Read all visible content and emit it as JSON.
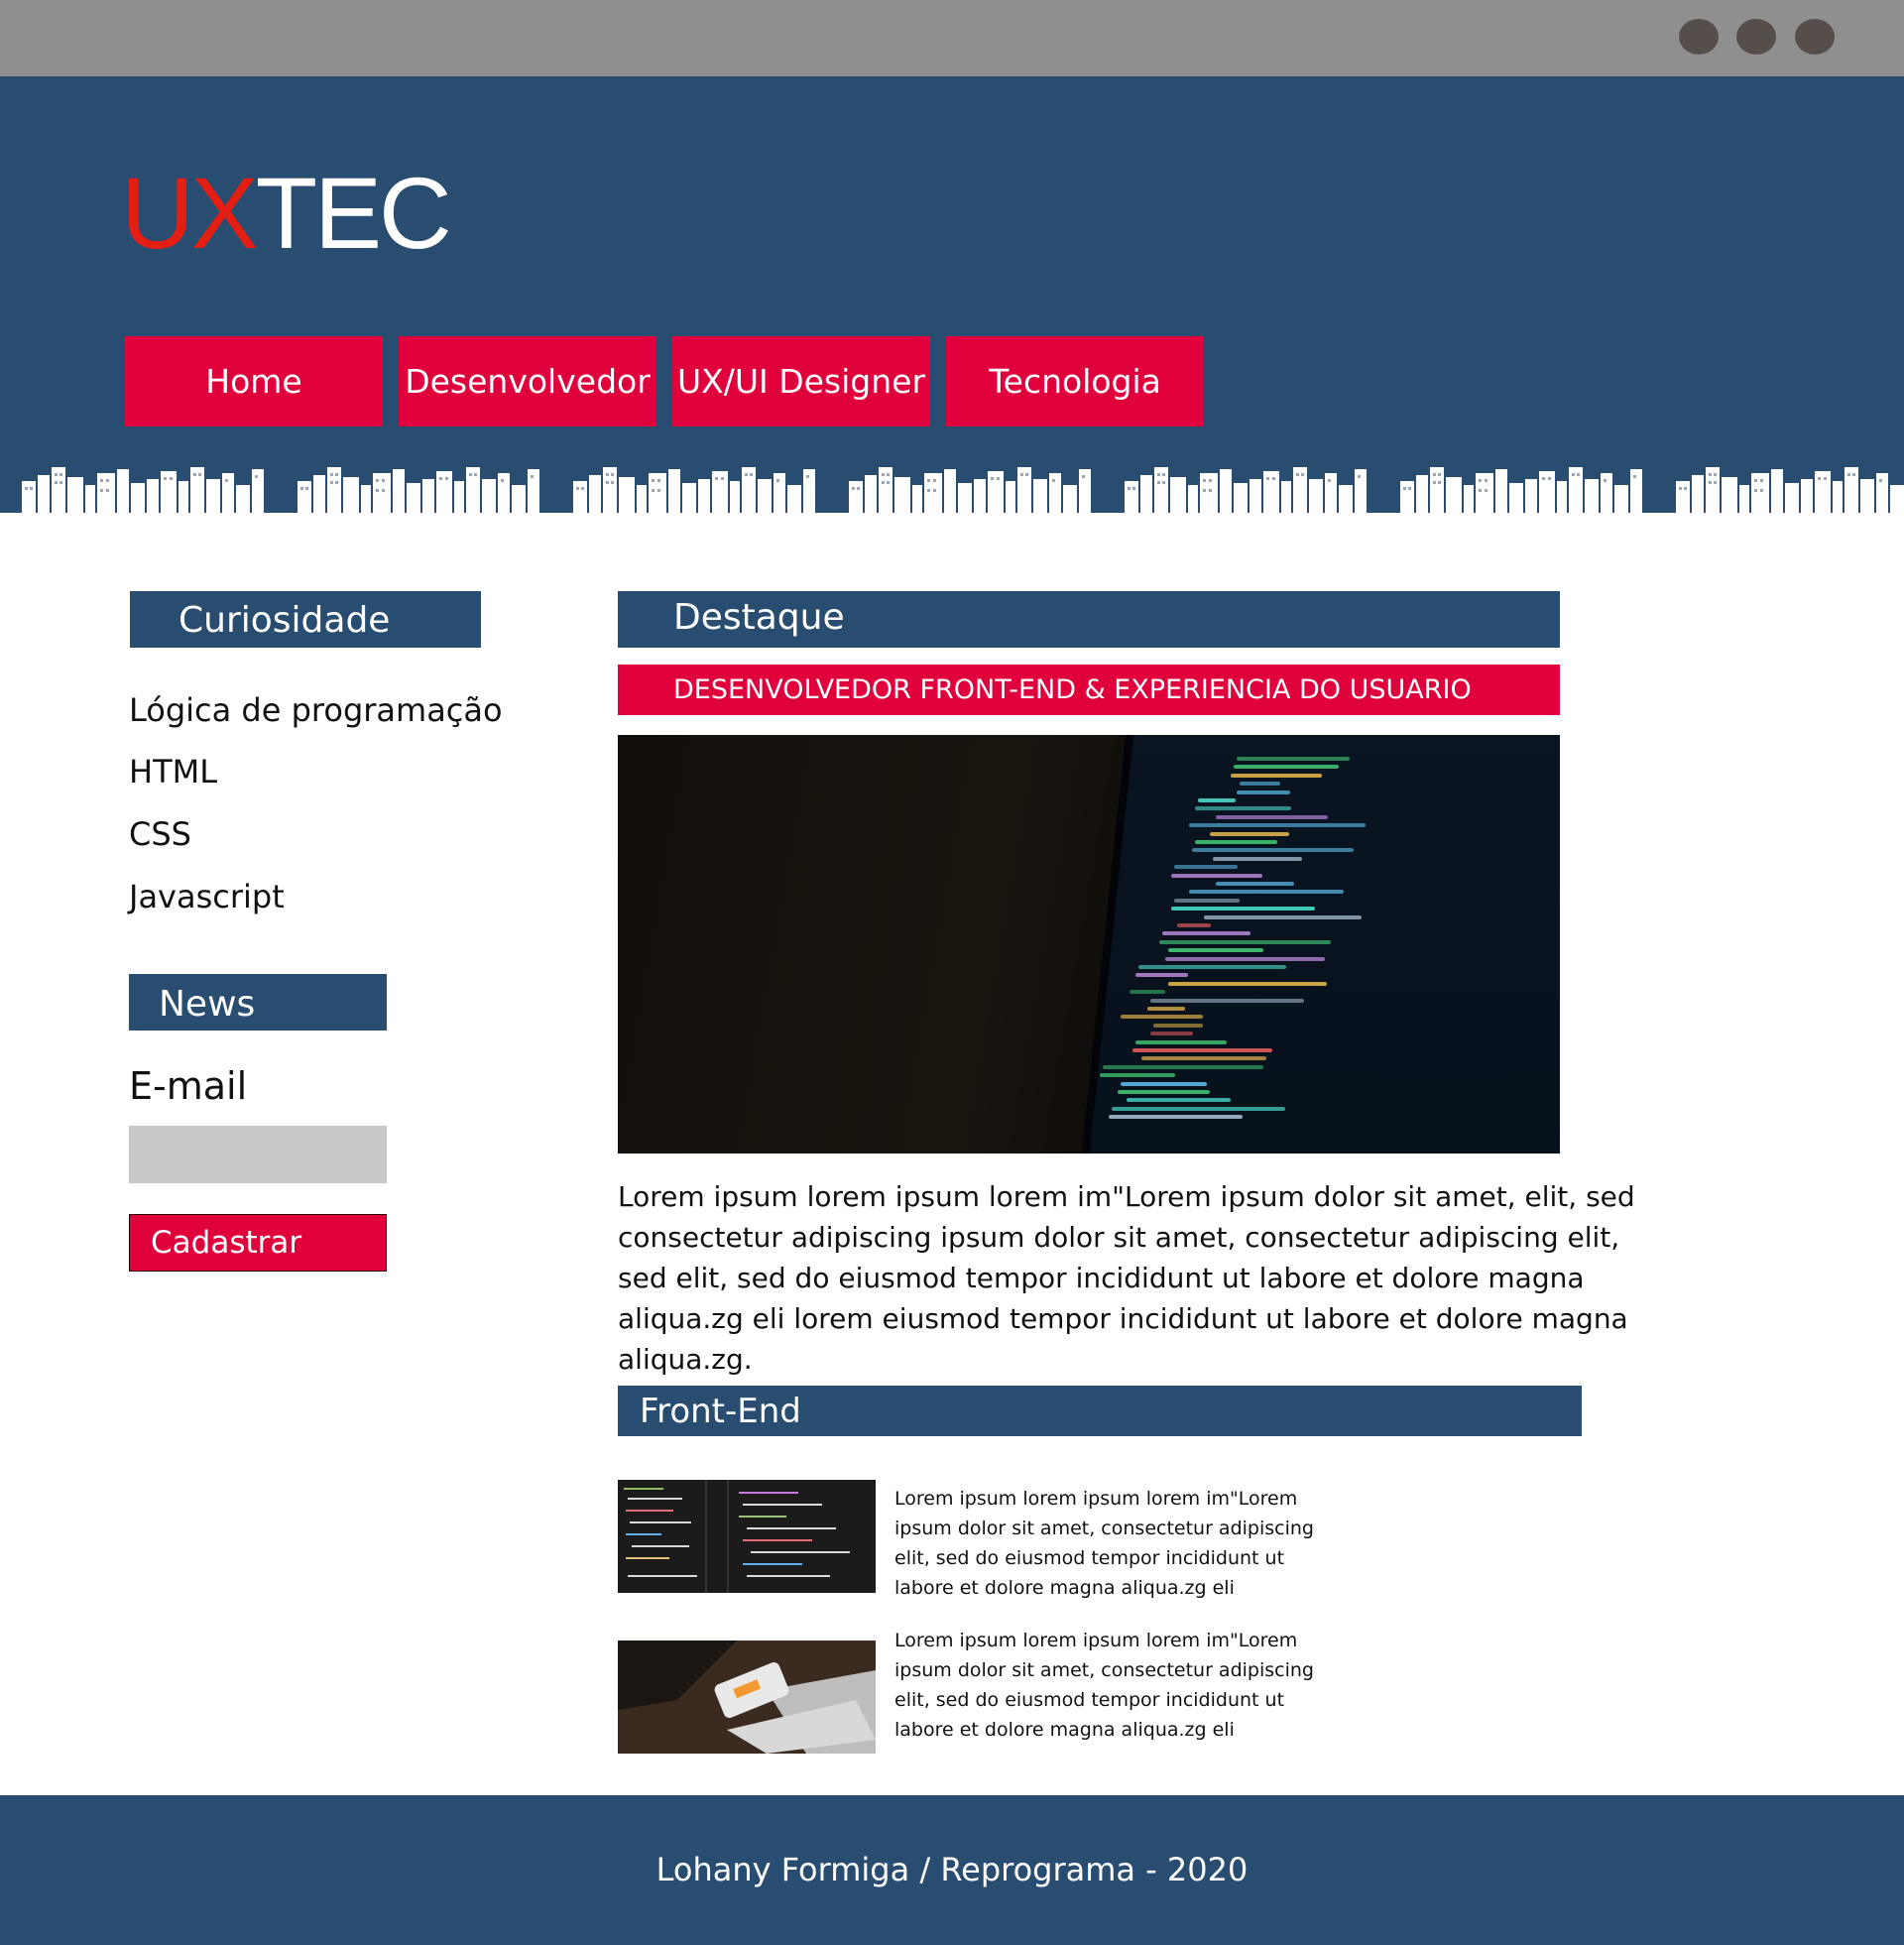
{
  "brand": {
    "part1": "UX",
    "part2": "TEC"
  },
  "nav": [
    {
      "label": "Home"
    },
    {
      "label": "Desenvolvedor"
    },
    {
      "label": "UX/UI Designer"
    },
    {
      "label": "Tecnologia"
    }
  ],
  "sidebar": {
    "curiosidade_title": "Curiosidade",
    "links": [
      "Lógica de programação",
      "HTML",
      "CSS",
      "Javascript"
    ],
    "news_title": "News",
    "email_label": "E-mail",
    "email_placeholder": "",
    "submit_label": "Cadastrar"
  },
  "main": {
    "destaque_title": "Destaque",
    "subhead": "DESENVOLVEDOR FRONT-END & EXPERIENCIA DO USUARIO",
    "hero_image": "code-on-monitor-photo",
    "body": "Lorem ipsum lorem ipsum lorem im\"Lorem ipsum dolor sit amet, elit, sed consectetur adipiscing ipsum dolor sit amet, consectetur adipiscing elit, sed elit, sed do eiusmod tempor incididunt ut labore et dolore magna aliqua.zg eli lorem eiusmod tempor incididunt ut labore et dolore magna aliqua.zg.",
    "frontend_title": "Front-End",
    "articles": [
      {
        "image": "code-editor-photo",
        "text": "Lorem ipsum lorem ipsum lorem im\"Lorem\nipsum dolor sit amet, consectetur adipiscing\nelit, sed do eiusmod tempor incididunt ut\n labore et dolore magna aliqua.zg eli"
      },
      {
        "image": "laptop-phone-desk-photo",
        "text": "Lorem ipsum lorem ipsum lorem im\"Lorem\nipsum dolor sit amet, consectetur adipiscing\nelit, sed do eiusmod tempor incididunt ut\n labore et dolore magna aliqua.zg eli"
      }
    ]
  },
  "footer": {
    "text": "Lohany Formiga / Reprograma - 2020"
  },
  "colors": {
    "navy": "#294d71",
    "red": "#df003c",
    "logo_red": "#e51e14",
    "chrome": "#8f8f8f"
  }
}
